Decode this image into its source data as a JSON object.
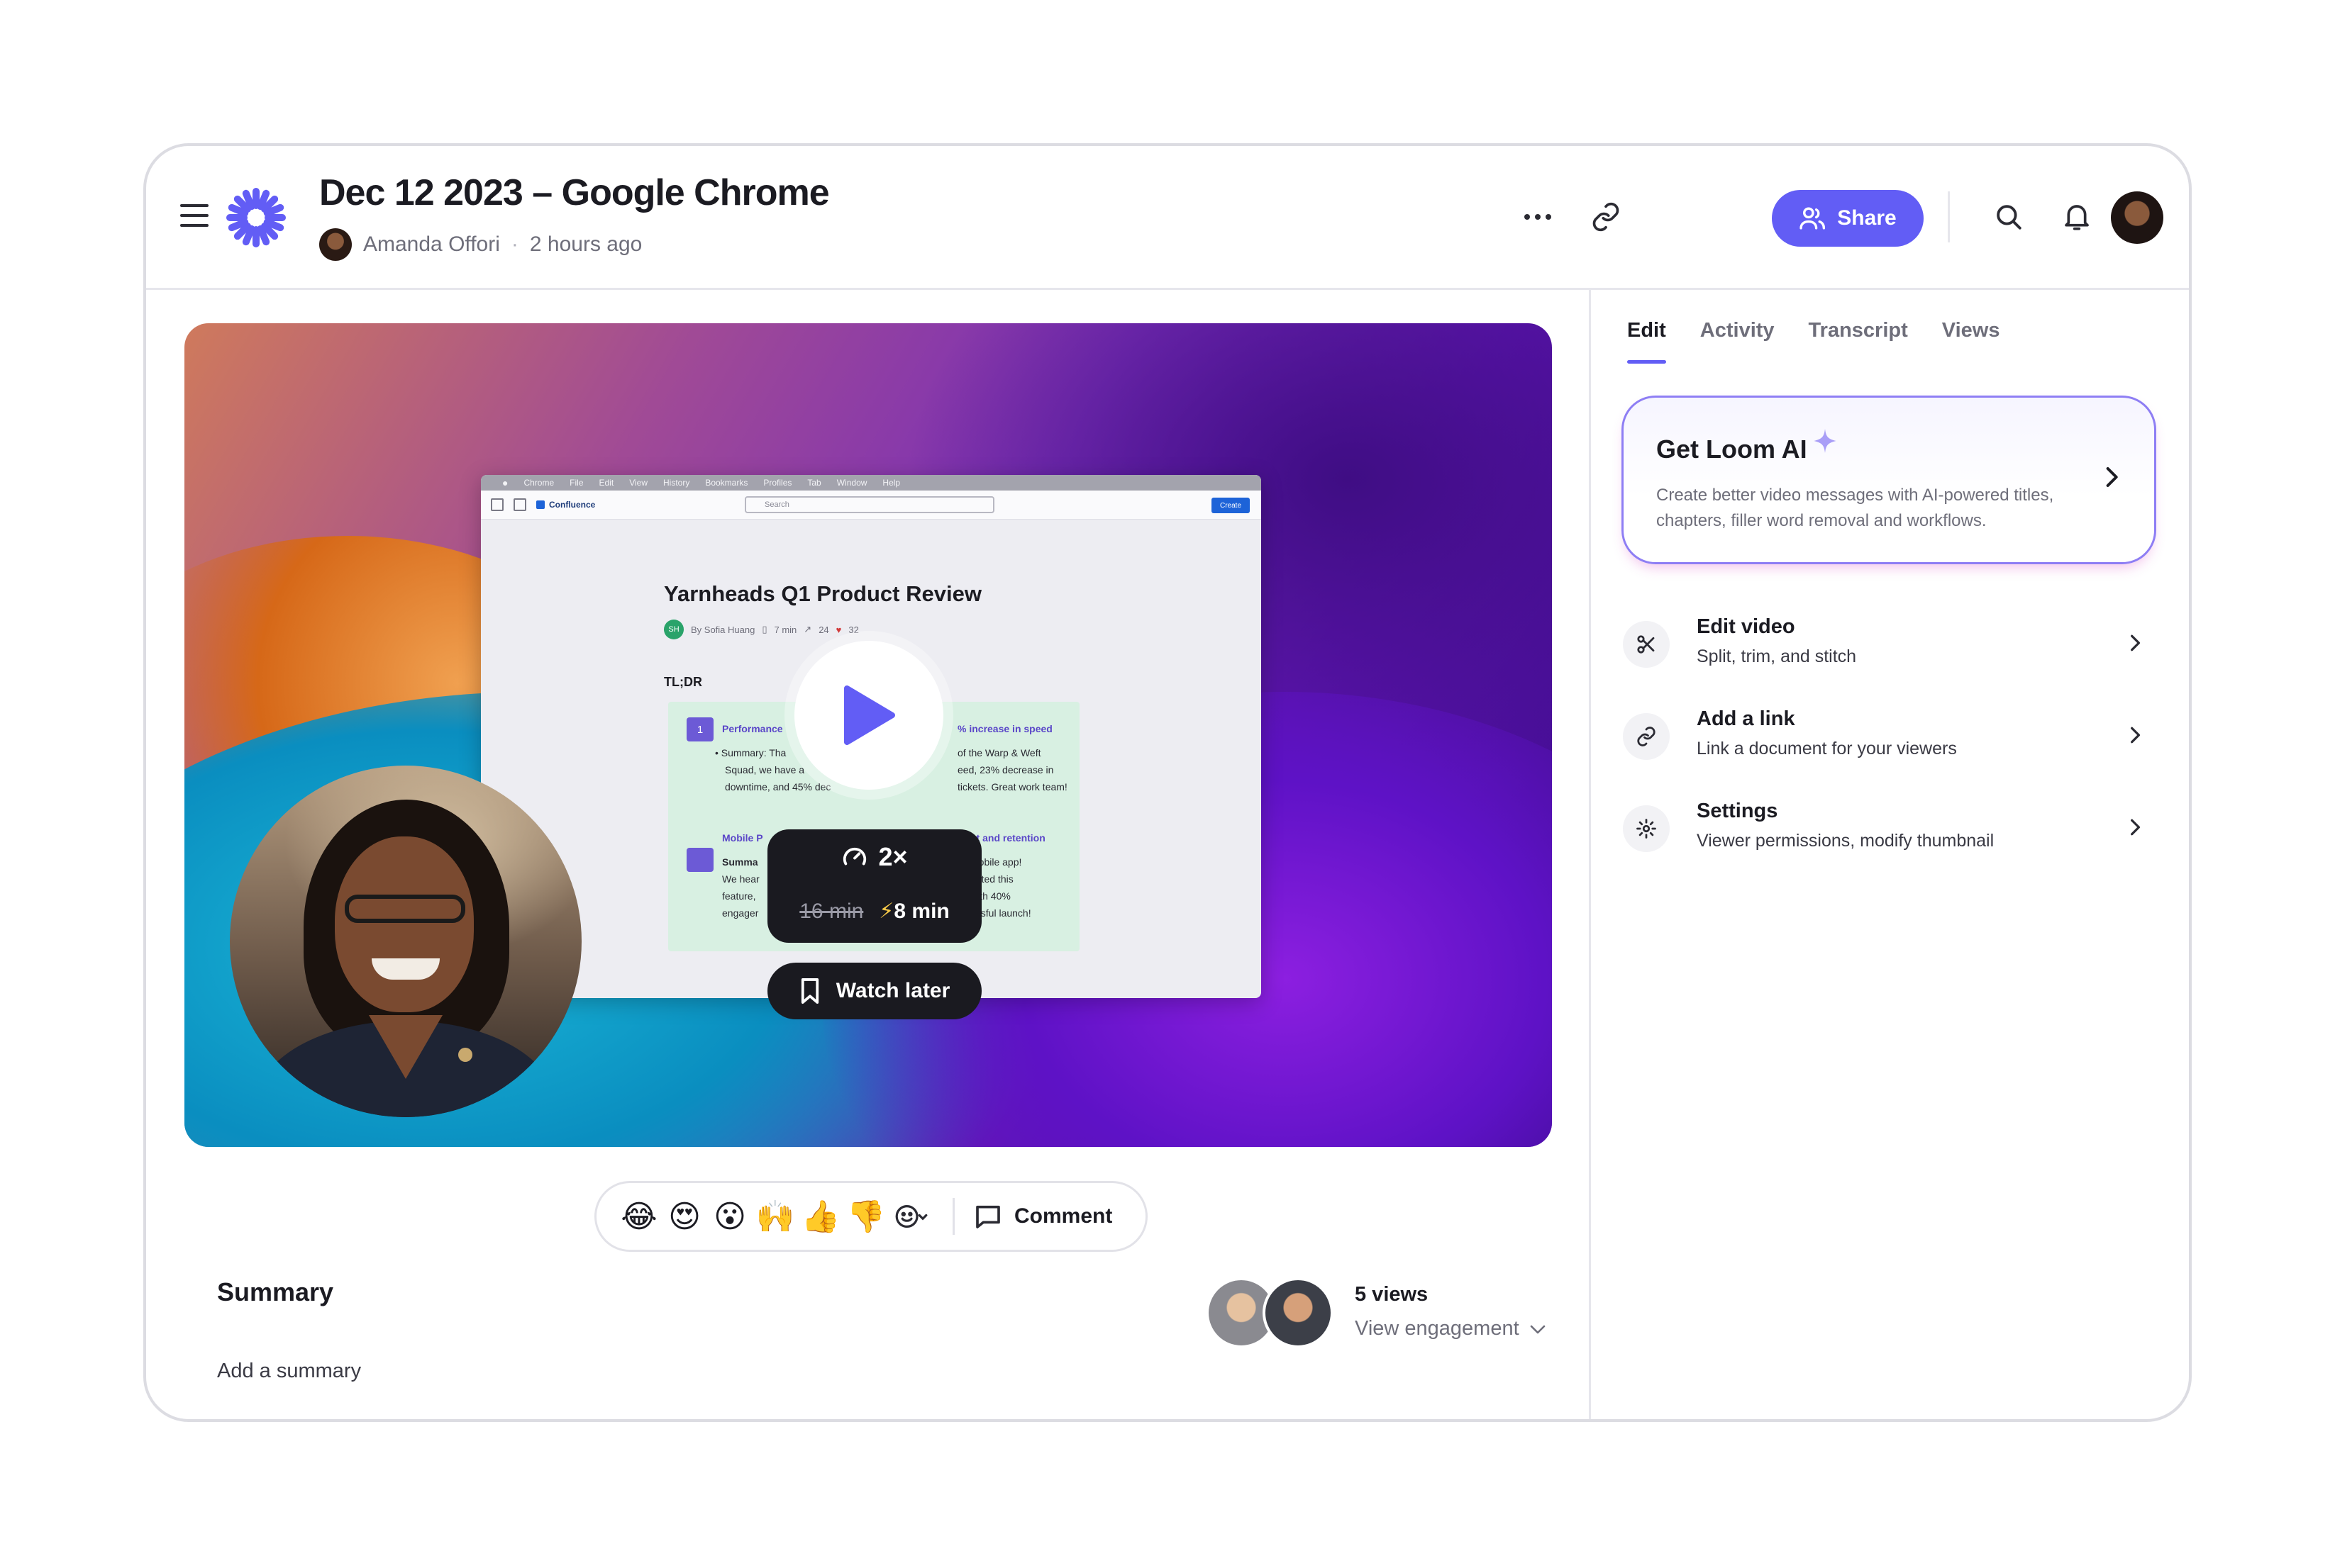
{
  "header": {
    "title": "Dec 12 2023 – Google Chrome",
    "author": "Amanda Offori",
    "separator": "·",
    "time_ago": "2 hours ago",
    "share_label": "Share"
  },
  "video": {
    "screen": {
      "menubar": [
        "Chrome",
        "File",
        "Edit",
        "View",
        "History",
        "Bookmarks",
        "Profiles",
        "Tab",
        "Window",
        "Help"
      ],
      "app_name": "Confluence",
      "search_placeholder": "Search",
      "create_label": "Create",
      "doc_title": "Yarnheads Q1 Product Review",
      "author_initials": "SH",
      "author": "By Sofia Huang",
      "read_time": "7 min",
      "views": "24",
      "reactions": "32",
      "tldr": "TL;DR",
      "item1_num": "1",
      "item1_head_left": "Performance",
      "item1_head_right": "% increase in speed",
      "item1_line1_left": "• Summary: Tha",
      "item1_line1_right": "of the Warp & Weft",
      "item1_line2_left": "Squad, we have a",
      "item1_line2_right": "eed, 23% decrease in",
      "item1_line3_left": "downtime, and 45% dec",
      "item1_line3_right": "tickets. Great work team!",
      "item2_head_left": "Mobile P",
      "item2_head_right": "nt and retention",
      "item2_line1_left": "Summa",
      "item2_line1_right": "mobile app!",
      "item2_line2_left": "We hear",
      "item2_line2_right": "anted this",
      "item2_line3_left": "feature,",
      "item2_line3_right": "with 40%",
      "item2_line4_left": "engager",
      "item2_line4_right": "essful launch!"
    },
    "speed": "2×",
    "original_time": "16 min",
    "fast_time": "8 min",
    "watch_later": "Watch later"
  },
  "reactions": {
    "emojis": [
      "😂",
      "😍",
      "😮",
      "🙌",
      "👍",
      "👎"
    ],
    "comment_label": "Comment"
  },
  "summary": {
    "heading": "Summary",
    "add_label": "Add a summary"
  },
  "engagement": {
    "views_label": "5 views",
    "view_engagement": "View engagement"
  },
  "panel": {
    "tabs": [
      "Edit",
      "Activity",
      "Transcript",
      "Views"
    ],
    "active_tab": "Edit",
    "ai_title": "Get Loom AI",
    "ai_desc": "Create better video messages with AI-powered titles, chapters, filler word removal and workflows.",
    "rows": [
      {
        "title": "Edit video",
        "desc": "Split, trim, and stitch",
        "icon": "scissors-icon"
      },
      {
        "title": "Add a link",
        "desc": "Link a document for your viewers",
        "icon": "link-icon"
      },
      {
        "title": "Settings",
        "desc": "Viewer permissions, modify thumbnail",
        "icon": "gear-icon"
      }
    ]
  },
  "colors": {
    "accent": "#625df5",
    "logo": "#625df5",
    "ai_border": "#8e7ef4"
  }
}
